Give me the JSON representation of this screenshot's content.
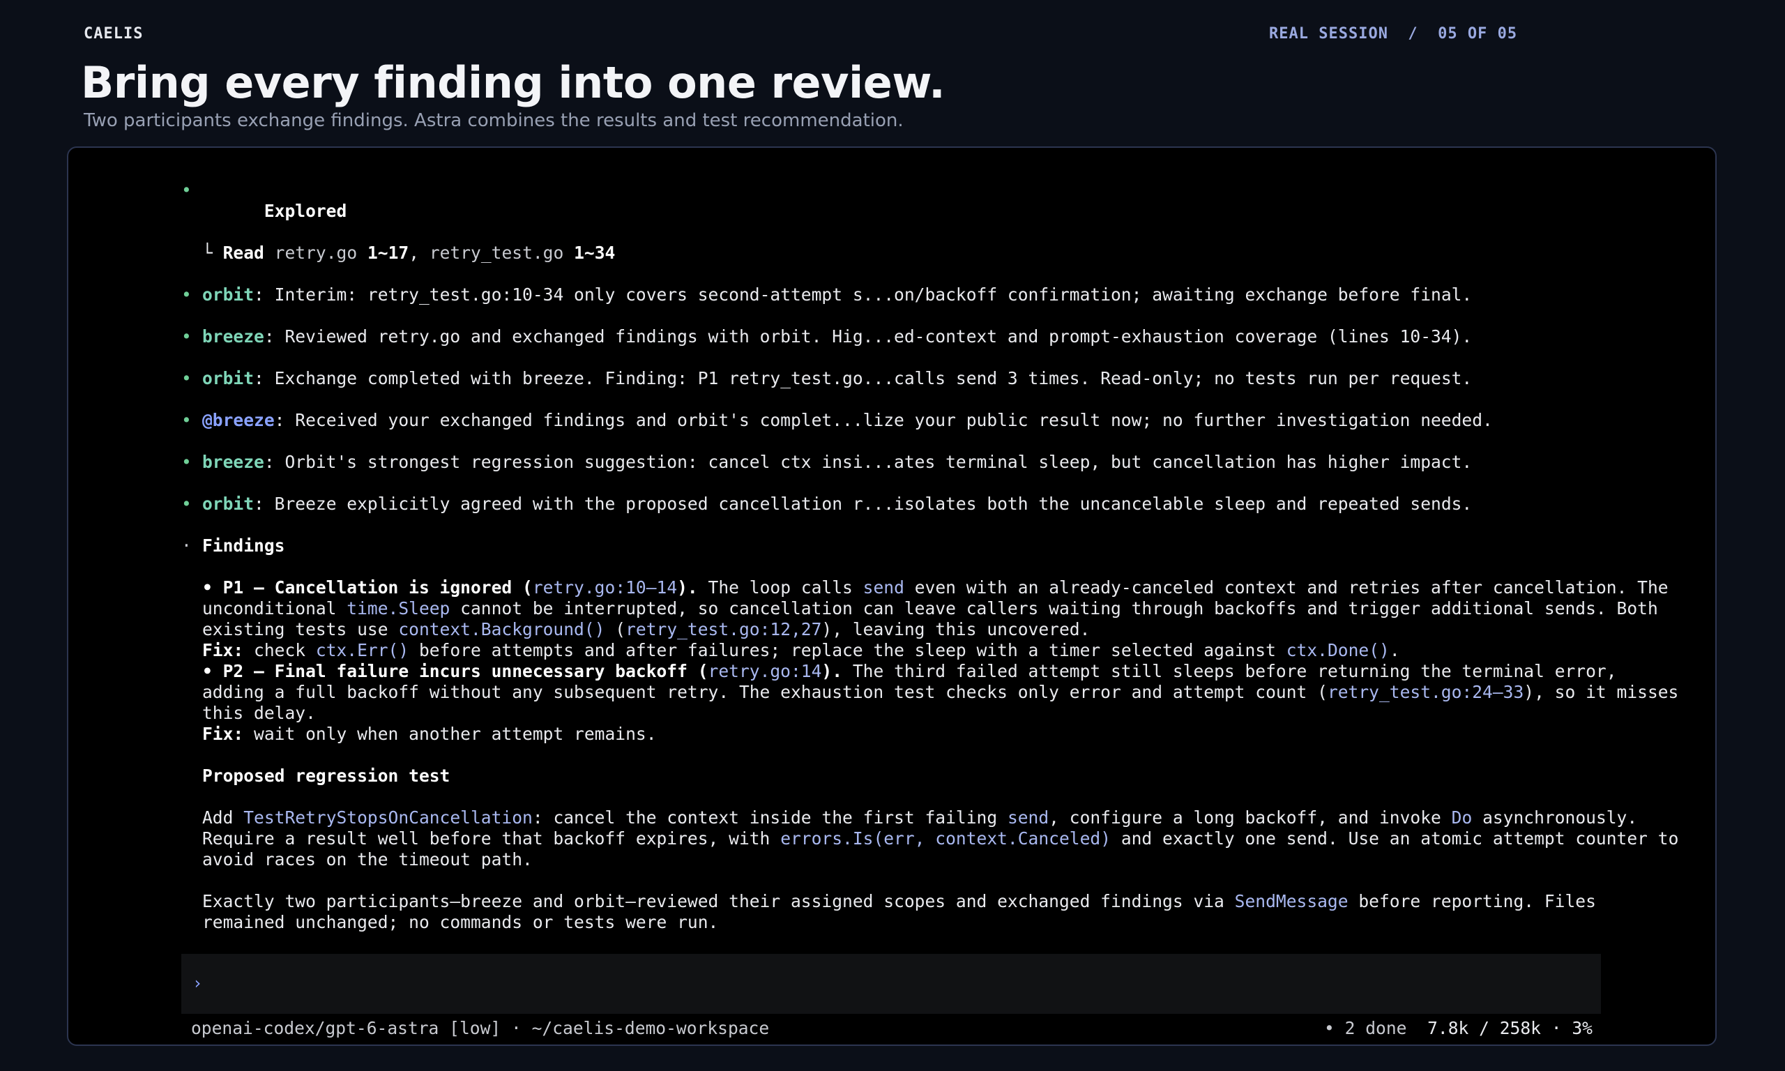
{
  "header": {
    "brand": "CAELIS",
    "session_label": "REAL SESSION  /  05 OF 05",
    "title": "Bring every finding into one review.",
    "subtitle": "Two participants exchange findings. Astra combines the results and test recommendation."
  },
  "transcript": {
    "explored": {
      "title": "Explored",
      "branch": "└ ",
      "read_label": "Read",
      "file1": "retry.go",
      "range1": "1~17",
      "sep": ", ",
      "file2": "retry_test.go",
      "range2": "1~34"
    },
    "messages": [
      {
        "agent": "orbit",
        "text": ": Interim: retry_test.go:10-34 only covers second-attempt s...on/backoff confirmation; awaiting exchange before final."
      },
      {
        "agent": "breeze",
        "text": ": Reviewed retry.go and exchanged findings with orbit. Hig...ed-context and prompt-exhaustion coverage (lines 10-34)."
      },
      {
        "agent": "orbit",
        "text": ": Exchange completed with breeze. Finding: P1 retry_test.go...calls send 3 times. Read-only; no tests run per request."
      },
      {
        "agent": "@breeze",
        "text": ": Received your exchanged findings and orbit's complet...lize your public result now; no further investigation needed."
      },
      {
        "agent": "breeze",
        "text": ": Orbit's strongest regression suggestion: cancel ctx insi...ates terminal sleep, but cancellation has higher impact."
      },
      {
        "agent": "orbit",
        "text": ": Breeze explicitly agreed with the proposed cancellation r...isolates both the uncancelable sleep and repeated sends."
      }
    ],
    "findings": {
      "heading": "Findings",
      "p1": {
        "title": "• P1 — Cancellation is ignored (",
        "ref": "retry.go:10–14",
        "title_end": ").",
        "t1": " The loop calls ",
        "c1": "send",
        "t2": " even with an already-canceled context and retries after cancellation. The unconditional ",
        "c2": "time.Sleep",
        "t3": " cannot be interrupted, so cancellation can leave callers waiting through backoffs and trigger additional sends. Both existing tests use ",
        "c3": "context.Background()",
        "t4": " (",
        "c4": "retry_test.go:12,27",
        "t5": "), leaving this uncovered.",
        "fix_label": "Fix:",
        "f1": " check ",
        "fc1": "ctx.Err()",
        "f2": " before attempts and after failures; replace the sleep with a timer selected against ",
        "fc2": "ctx.Done()",
        "f3": "."
      },
      "p2": {
        "title": "• P2 — Final failure incurs unnecessary backoff (",
        "ref": "retry.go:14",
        "title_end": ").",
        "t1": " The third failed attempt still sleeps before returning the terminal error, adding a full backoff without any subsequent retry. The exhaustion test checks only error and attempt count (",
        "c1": "retry_test.go:24–33",
        "t2": "), so it misses this delay.",
        "fix_label": "Fix:",
        "f1": " wait only when another attempt remains."
      }
    },
    "regression": {
      "heading": "Proposed regression test",
      "t0": "Add ",
      "c0": "TestRetryStopsOnCancellation",
      "t1": ": cancel the context inside the first failing ",
      "c1": "send",
      "t2": ", configure a long backoff, and invoke ",
      "c2": "Do",
      "t3": " asynchronously. Require a result well before that backoff expires, with ",
      "c3": "errors.Is(err, context.Canceled)",
      "t4": " and exactly one send. Use an atomic attempt counter to avoid races on the timeout path."
    },
    "summary": {
      "t0": "Exactly two participants—breeze and orbit—reviewed their assigned scopes and exchanged findings via ",
      "c0": "SendMessage",
      "t1": " before reporting. Files remained unchanged; no commands or tests were run."
    }
  },
  "prompt": {
    "caret": "›",
    "value": ""
  },
  "status_bar": {
    "model_info": "openai-codex/gpt-6-astra [low] · ~/caelis-demo-workspace",
    "done_dot": "•",
    "done": "2 done",
    "tokens": "7.8k / 258k · 3%"
  },
  "colors": {
    "background": "#0b0f18",
    "terminal_bg": "#000000",
    "agent": "#7fd6b8",
    "mention": "#8aa2ff",
    "code": "#a9b8f0",
    "bullet": "#6fcf97"
  }
}
